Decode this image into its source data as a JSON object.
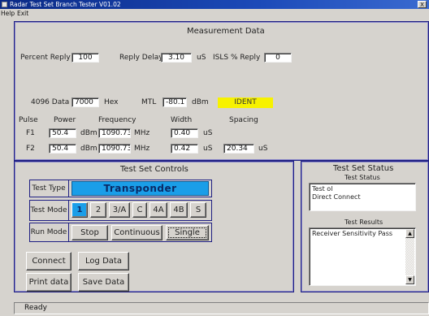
{
  "window": {
    "title": "Radar Test Set Branch Tester V01.02",
    "close_label": "X"
  },
  "menu": {
    "help": "Help",
    "exit": "Exit"
  },
  "measurement": {
    "title": "Measurement Data",
    "percent_reply_label": "Percent Reply",
    "percent_reply_value": "100",
    "reply_delay_label": "Reply Delay",
    "reply_delay_value": "3.10",
    "reply_delay_unit": "uS",
    "isls_label": "ISLS % Reply",
    "isls_value": "0",
    "code_data_label": "4096 Data",
    "code_data_value": "7000",
    "code_data_unit": "Hex",
    "mtl_label": "MTL",
    "mtl_value": "-80.1",
    "mtl_unit": "dBm",
    "ident_label": "IDENT",
    "pulse_label": "Pulse",
    "power_label": "Power",
    "frequency_label": "Frequency",
    "width_label": "Width",
    "spacing_label": "Spacing",
    "f1": {
      "label": "F1",
      "power": "50.4",
      "power_unit": "dBm",
      "freq": "1090.73",
      "freq_unit": "MHz",
      "width": "0.40",
      "width_unit": "uS"
    },
    "f2": {
      "label": "F2",
      "power": "50.4",
      "power_unit": "dBm",
      "freq": "1090.73",
      "freq_unit": "MHz",
      "width": "0.42",
      "width_unit": "uS",
      "spacing": "20.34",
      "spacing_unit": "uS"
    }
  },
  "controls": {
    "title": "Test Set Controls",
    "test_type_label": "Test Type",
    "test_type_value": "Transponder",
    "test_mode_label": "Test Mode",
    "modes": [
      "1",
      "2",
      "3/A",
      "C",
      "4A",
      "4B",
      "S"
    ],
    "run_mode_label": "Run Mode",
    "run_modes": [
      "Stop",
      "Continuous",
      "Single"
    ],
    "connect_label": "Connect",
    "log_data_label": "Log Data",
    "print_data_label": "Print data",
    "save_data_label": "Save Data"
  },
  "status": {
    "title": "Test Set Status",
    "test_status_label": "Test Status",
    "test_status_lines": [
      "Test ol",
      "Direct Connect"
    ],
    "test_results_label": "Test Results",
    "test_results_lines": [
      "Receiver Sensitivity Pass"
    ]
  },
  "statusbar": {
    "text": "Ready"
  }
}
